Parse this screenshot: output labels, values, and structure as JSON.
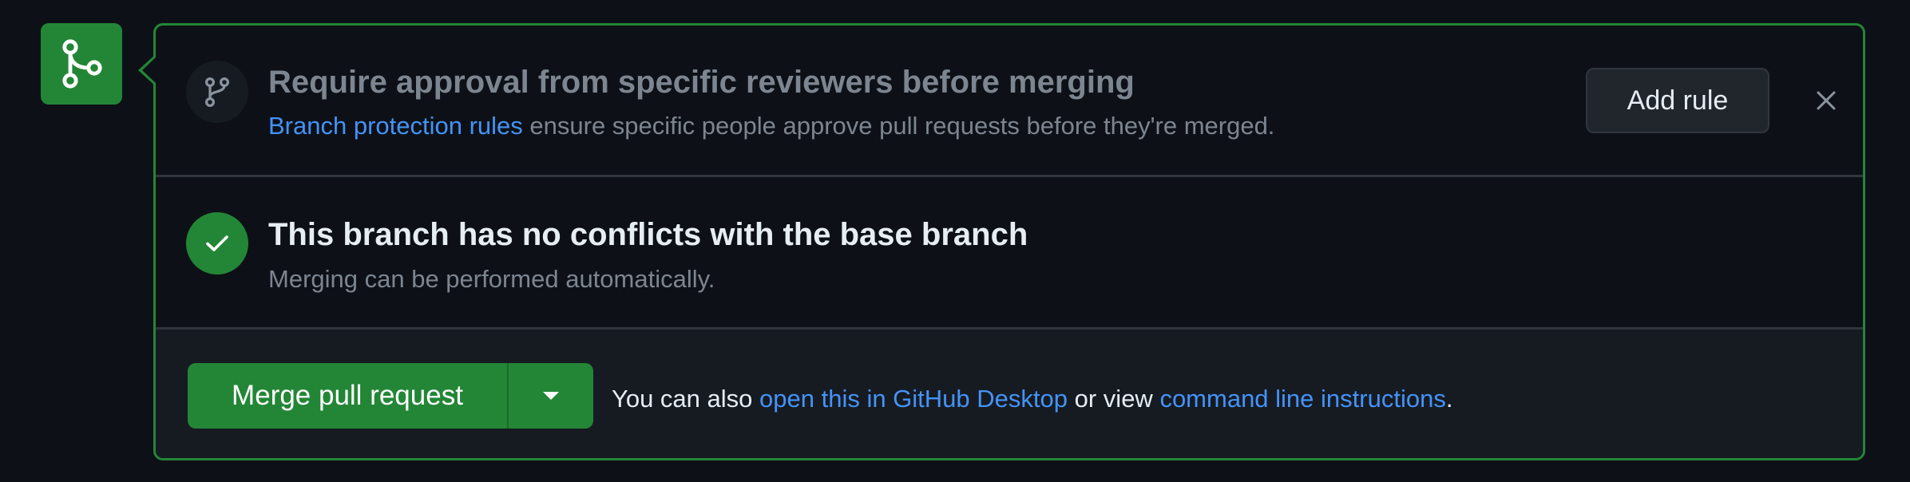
{
  "merge_panel": {
    "tile_icon": "git-merge-icon",
    "protection_notice": {
      "icon": "git-branch-icon",
      "title": "Require approval from specific reviewers before merging",
      "link_text": "Branch protection rules",
      "description": " ensure specific people approve pull requests before they're merged.",
      "add_rule_label": "Add rule",
      "dismiss_icon": "close-icon"
    },
    "conflict_status": {
      "icon": "check-icon",
      "title": "This branch has no conflicts with the base branch",
      "description": "Merging can be performed automatically."
    },
    "merge_actions": {
      "merge_button_label": "Merge pull request",
      "dropdown_icon": "triangle-down-icon",
      "prefix_text": "You can also ",
      "desktop_link": "open this in GitHub Desktop",
      "middle_text": " or view ",
      "cli_link": "command line instructions",
      "suffix_text": "."
    }
  },
  "colors": {
    "background": "#0d1117",
    "success_green": "#238636",
    "link_blue": "#4493f8",
    "border": "#30363d",
    "muted_text": "#7d8590",
    "primary_text": "#e6edf3"
  }
}
